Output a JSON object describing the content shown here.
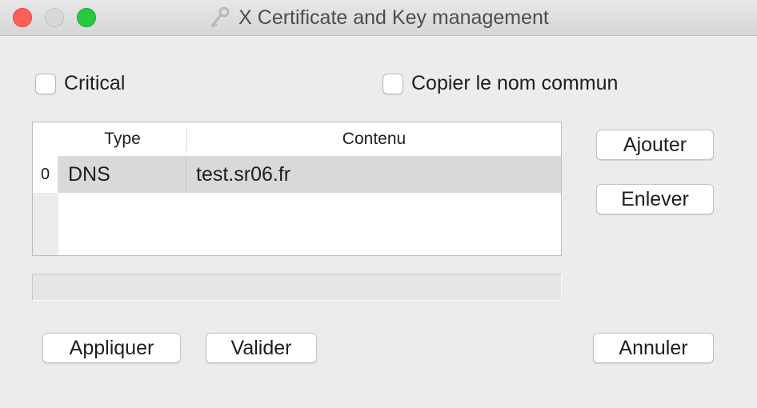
{
  "window": {
    "title": "X Certificate and Key management",
    "icon": "certificate-key-icon"
  },
  "options": {
    "critical_label": "Critical",
    "critical_checked": false,
    "copy_cn_label": "Copier le nom commun",
    "copy_cn_checked": false
  },
  "table": {
    "headers": [
      "Type",
      "Contenu"
    ],
    "rows": [
      {
        "index": "0",
        "type": "DNS",
        "value": "test.sr06.fr"
      }
    ]
  },
  "input": {
    "value": ""
  },
  "buttons": {
    "add": "Ajouter",
    "remove": "Enlever",
    "apply": "Appliquer",
    "validate": "Valider",
    "cancel": "Annuler"
  },
  "colors": {
    "close": "#fe5f57",
    "minimize": "#d8d8d8",
    "maximize": "#28c840",
    "selected_row": "#d9d9d9"
  }
}
